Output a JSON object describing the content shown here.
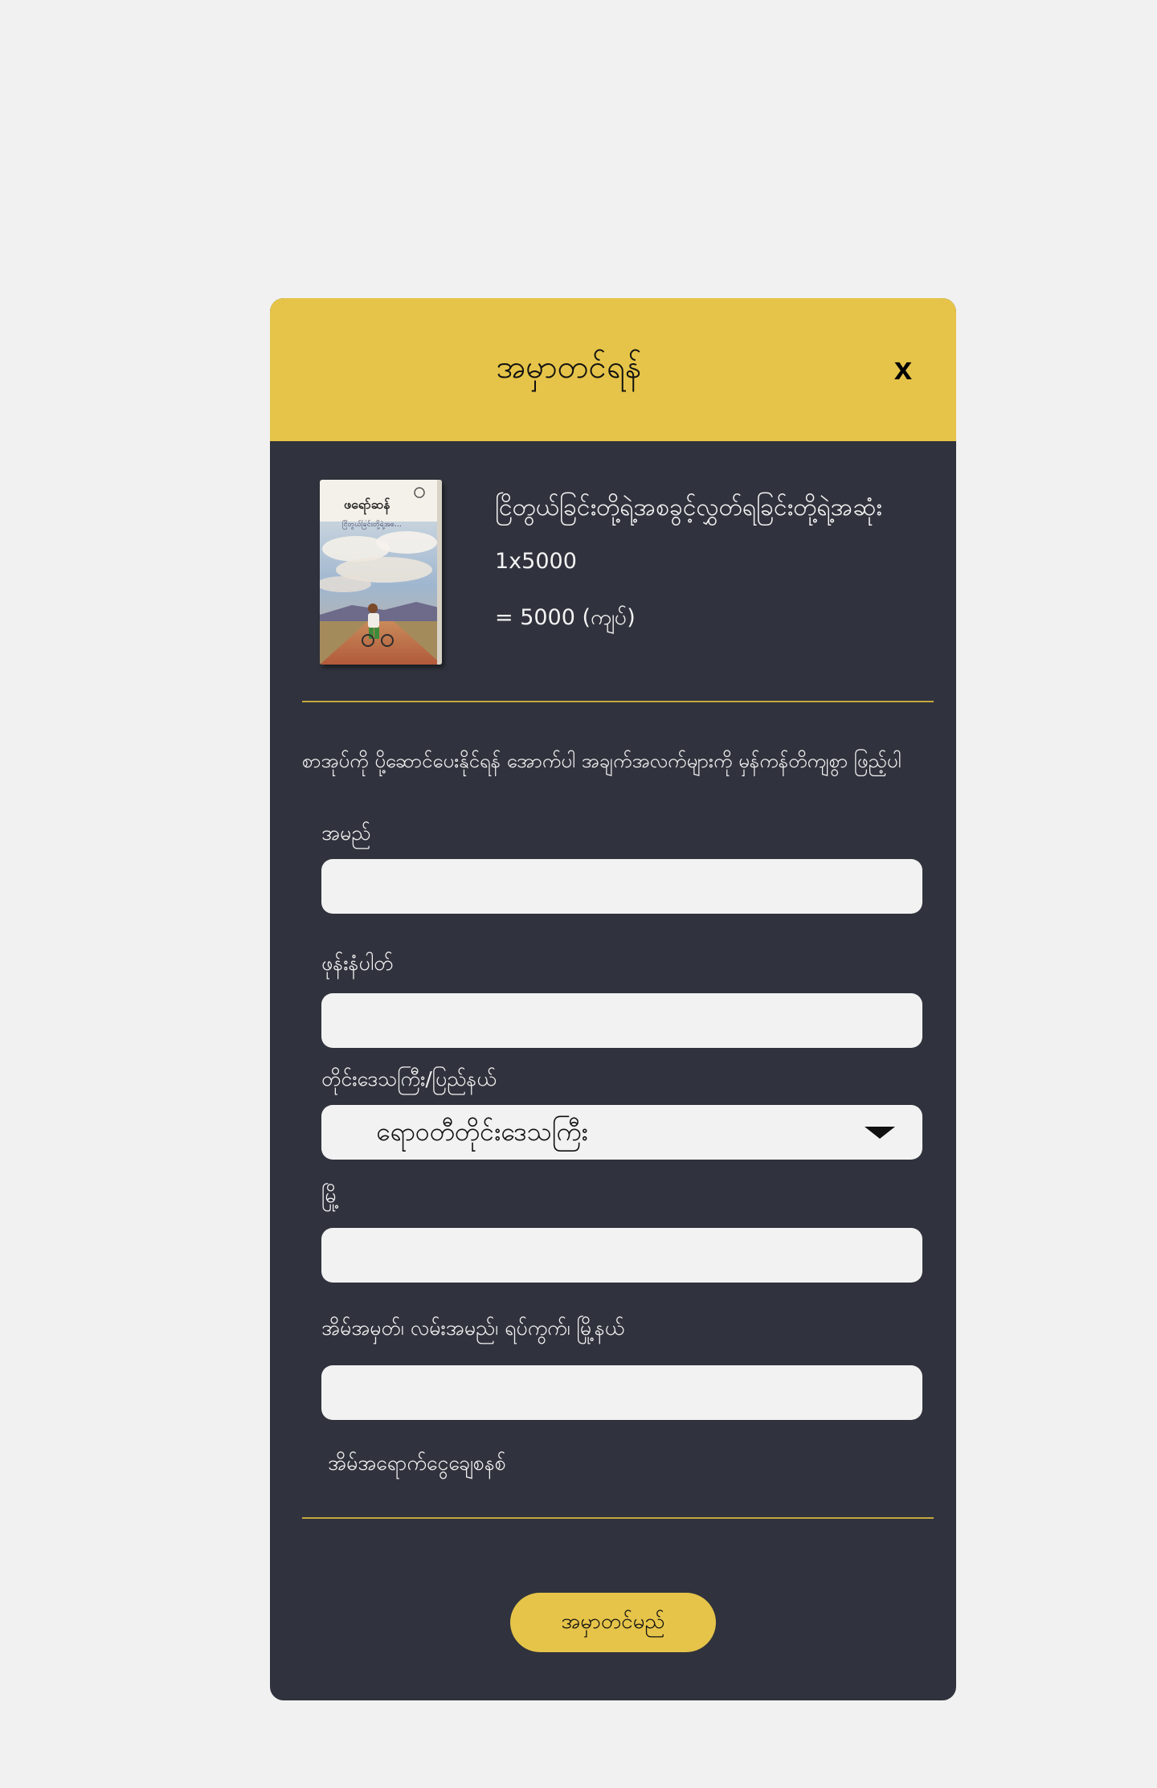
{
  "modal": {
    "title": "အမှာတင်ရန်",
    "close_label": "x"
  },
  "product": {
    "cover_author": "ဖရော်ဆန်",
    "cover_subtitle": "ငြိတွယ်ခြင်းတို့ရဲ့အစ...",
    "title": "ငြိတွယ်ခြင်းတို့ရဲ့အစခွင့်လွှတ်ရခြင်းတို့ရဲ့အဆုံး",
    "quantity_line": "1x5000",
    "total_line": "= 5000 (ကျပ်)"
  },
  "form": {
    "instruction": "စာအုပ်ကို ပို့ဆောင်ပေးနိုင်ရန် အောက်ပါ အချက်အလက်များကို မှန်ကန်တိကျစွာ ဖြည့်ပါ",
    "name_label": "အမည်",
    "name_value": "",
    "phone_label": "ဖုန်းနံပါတ်",
    "phone_value": "",
    "region_label": "တိုင်းဒေသကြီး/ပြည်နယ်",
    "region_selected": "ရောဝတီတိုင်းဒေသကြီး",
    "city_label": "မြို့",
    "city_value": "",
    "address_label": "အိမ်အမှတ်၊ လမ်းအမည်၊ ရပ်ကွက်၊ မြို့နယ်",
    "address_value": "",
    "payment_label": "အိမ်အရောက်ငွေချေစနစ်",
    "submit_label": "အမှာတင်မည်"
  },
  "colors": {
    "accent": "#e6c449",
    "panel": "#30333d",
    "page_background": "#f1f1f1",
    "input_background": "#f2f2f2"
  },
  "icons": {
    "close": "close-icon",
    "dropdown": "chevron-down-icon"
  }
}
